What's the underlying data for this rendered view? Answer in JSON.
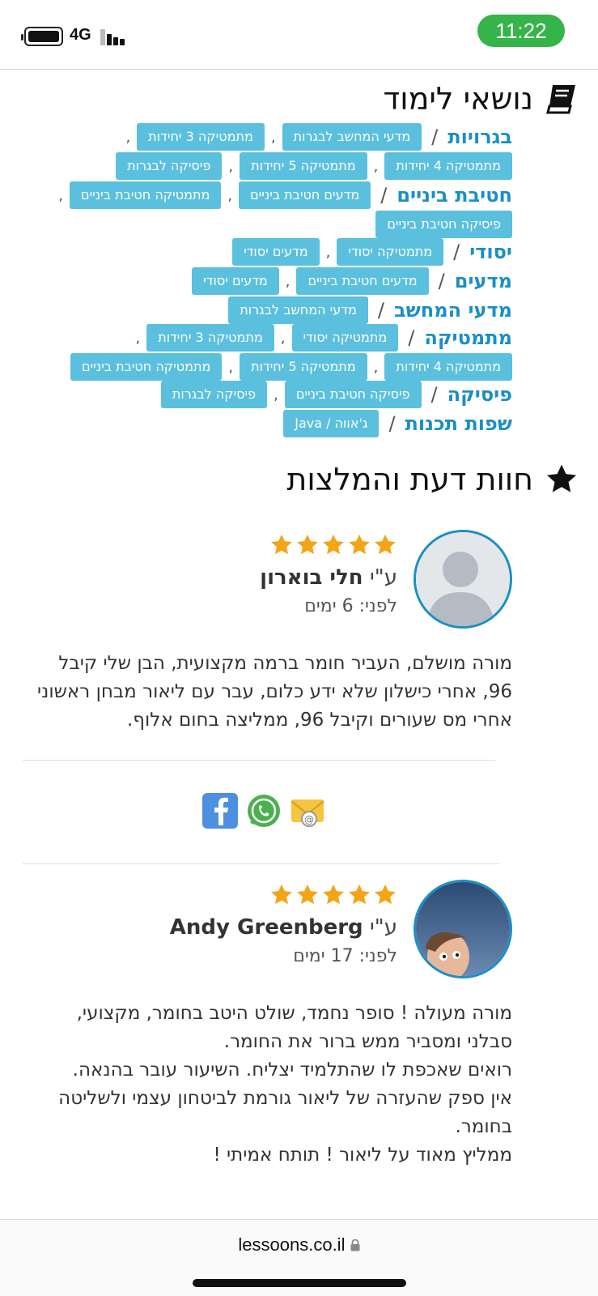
{
  "status": {
    "network": "4G",
    "time": "11:22",
    "battery_level": 1.0,
    "signal_bars": 3
  },
  "topics_title": "נושאי לימוד",
  "topics": [
    {
      "category": "בגרויות",
      "tags": [
        "מדעי המחשב לבגרות",
        "מתמטיקה 3 יחידות",
        "מתמטיקה 4 יחידות",
        "מתמטיקה 5 יחידות",
        "פיסיקה לבגרות"
      ]
    },
    {
      "category": "חטיבת ביניים",
      "tags": [
        "מדעים חטיבת ביניים",
        "מתמטיקה חטיבת ביניים",
        "פיסיקה חטיבת ביניים"
      ]
    },
    {
      "category": "יסודי",
      "tags": [
        "מתמטיקה יסודי",
        "מדעים יסודי"
      ]
    },
    {
      "category": "מדעים",
      "tags": [
        "מדעים חטיבת ביניים",
        "מדעים יסודי"
      ]
    },
    {
      "category": "מדעי המחשב",
      "tags": [
        "מדעי המחשב לבגרות"
      ]
    },
    {
      "category": "מתמטיקה",
      "tags": [
        "מתמטיקה יסודי",
        "מתמטיקה 3 יחידות",
        "מתמטיקה 4 יחידות",
        "מתמטיקה 5 יחידות",
        "מתמטיקה חטיבת ביניים"
      ]
    },
    {
      "category": "פיסיקה",
      "tags": [
        "פיסיקה חטיבת ביניים",
        "פיסיקה לבגרות"
      ]
    },
    {
      "category": "שפות תכנות",
      "tags": [
        "ג'אווה / Java"
      ]
    }
  ],
  "reviews_title": "חוות דעת והמלצות",
  "reviews": [
    {
      "by_prefix": "ע\"י",
      "name": "חלי בוארון",
      "when": "לפני: 6 ימים",
      "rating": 5,
      "text": [
        "מורה מושלם, העביר חומר ברמה מקצועית, הבן שלי קיבל 96, אחרי כישלון שלא ידע כלום, עבר עם ליאור מבחן ראשוני אחרי מס שעורים וקיבל 96, ממליצה בחום אלוף."
      ]
    },
    {
      "by_prefix": "ע\"י",
      "name": "Andy Greenberg",
      "when": "לפני: 17 ימים",
      "rating": 5,
      "text": [
        "מורה מעולה ! סופר נחמד, שולט היטב בחומר, מקצועי, סבלני ומסביר ממש ברור את החומר.",
        "רואים שאכפת לו שהתלמיד יצליח. השיעור עובר בהנאה.",
        "אין ספק שהעזרה של ליאור גורמת לביטחון עצמי ולשליטה בחומר.",
        "ממליץ מאוד על ליאור ! תותח אמיתי !"
      ]
    }
  ],
  "share": {
    "icons": [
      "facebook-icon",
      "whatsapp-icon",
      "email-icon"
    ]
  },
  "colors": {
    "accent": "#1b8fc4",
    "tag": "#5bc0de",
    "star": "#f4a417",
    "status_green": "#35b44a"
  },
  "browser": {
    "url": "lessoons.co.il"
  }
}
